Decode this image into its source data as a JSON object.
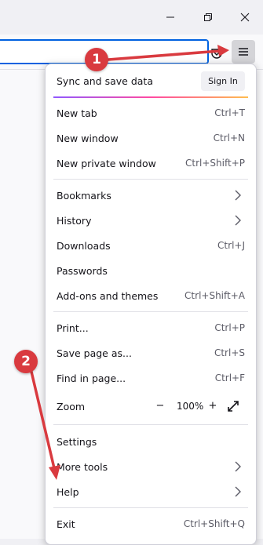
{
  "window": {
    "minimize_icon": "minimize-icon",
    "restore_icon": "restore-icon",
    "close_icon": "close-icon"
  },
  "toolbar": {
    "url_value": "",
    "pocket_icon": "pocket-icon",
    "menu_icon": "hamburger-menu-icon"
  },
  "panel": {
    "sync_label": "Sync and save data",
    "signin_label": "Sign In",
    "items": {
      "new_tab": {
        "label": "New tab",
        "shortcut": "Ctrl+T"
      },
      "new_window": {
        "label": "New window",
        "shortcut": "Ctrl+N"
      },
      "new_private": {
        "label": "New private window",
        "shortcut": "Ctrl+Shift+P"
      },
      "bookmarks": {
        "label": "Bookmarks"
      },
      "history": {
        "label": "History"
      },
      "downloads": {
        "label": "Downloads",
        "shortcut": "Ctrl+J"
      },
      "passwords": {
        "label": "Passwords"
      },
      "addons": {
        "label": "Add-ons and themes",
        "shortcut": "Ctrl+Shift+A"
      },
      "print": {
        "label": "Print...",
        "shortcut": "Ctrl+P"
      },
      "save_page": {
        "label": "Save page as...",
        "shortcut": "Ctrl+S"
      },
      "find": {
        "label": "Find in page...",
        "shortcut": "Ctrl+F"
      },
      "zoom": {
        "label": "Zoom",
        "minus": "−",
        "value": "100%",
        "plus": "+"
      },
      "settings": {
        "label": "Settings"
      },
      "more_tools": {
        "label": "More tools"
      },
      "help": {
        "label": "Help"
      },
      "exit": {
        "label": "Exit",
        "shortcut": "Ctrl+Shift+Q"
      }
    }
  },
  "annotations": {
    "step1": "1",
    "step2": "2",
    "color": "#d93a3f"
  }
}
